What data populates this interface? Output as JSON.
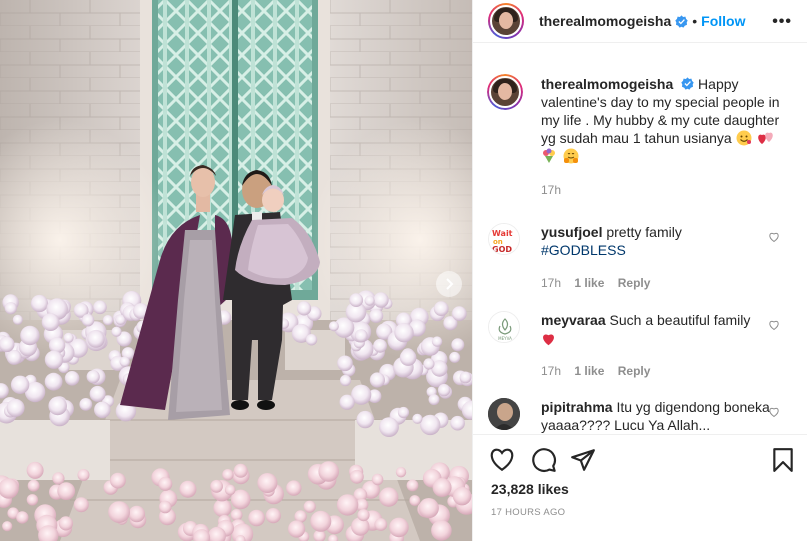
{
  "post": {
    "image_alt": "Family photo: woman in purple gown, man in dark suit holding baby in lilac dress, in front of teal doors with flowers",
    "next_icon": "chevron-right-icon"
  },
  "header": {
    "username": "therealmomogeisha",
    "separator": "•",
    "follow_label": "Follow",
    "more_label": "•••"
  },
  "caption": {
    "username": "therealmomogeisha",
    "text": "Happy valentine's day to my special people in my life . My hubby & my cute daughter yg sudah mau 1 tahun usianya",
    "emojis": [
      "smile-emoji",
      "hearts-emoji",
      "bouquet-emoji",
      "hug-emoji"
    ],
    "time": "17h"
  },
  "comments": [
    {
      "username": "yusufjoel",
      "text_plain": "pretty family ",
      "hashtag": "#GODBLESS",
      "time": "17h",
      "likes": "1 like",
      "reply": "Reply"
    },
    {
      "username": "meyvaraa",
      "text_plain": "Such a beautiful family",
      "time": "17h",
      "likes": "1 like",
      "reply": "Reply"
    },
    {
      "username": "pipitrahma",
      "text_plain": "Itu yg digendong boneka yaaaa???? Lucu Ya Allah..."
    }
  ],
  "actions": {
    "like_icon": "heart-icon",
    "comment_icon": "comment-icon",
    "share_icon": "share-icon",
    "save_icon": "bookmark-icon",
    "likes_count": "23,828 likes",
    "time_ago": "17 HOURS AGO"
  },
  "colors": {
    "link_blue": "#0095f6",
    "hashtag": "#00376b",
    "muted": "#8e8e8e",
    "heart_red": "#ed4956"
  }
}
